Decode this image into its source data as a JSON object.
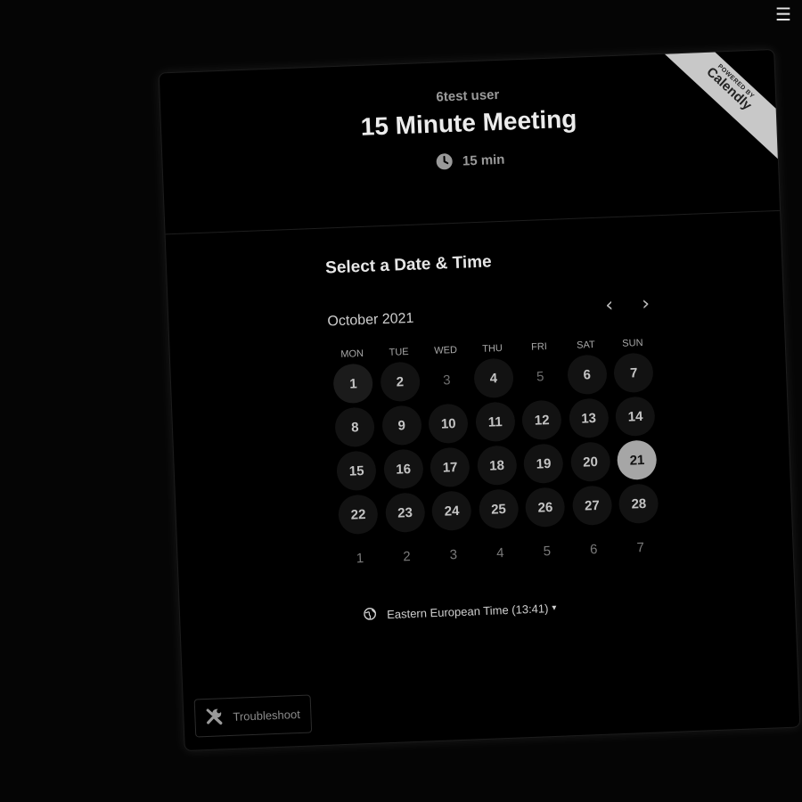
{
  "menu": {
    "icon": "hamburger-menu-icon",
    "glyph": "☰"
  },
  "ribbon": {
    "small_label": "POWERED BY",
    "brand": "Calendly"
  },
  "event": {
    "host": "6test user",
    "title": "15 Minute Meeting",
    "duration": "15 min",
    "duration_icon": "clock-icon"
  },
  "picker": {
    "heading": "Select a Date & Time",
    "month": "October 2021",
    "prev_icon": "chevron-left-icon",
    "next_icon": "chevron-right-icon",
    "prev_glyph": "‹",
    "next_glyph": "›",
    "weekdays": [
      "MON",
      "TUE",
      "WED",
      "THU",
      "FRI",
      "SAT",
      "SUN"
    ],
    "weeks": [
      [
        {
          "d": "1",
          "s": "available"
        },
        {
          "d": "2",
          "s": "available"
        },
        {
          "d": "3",
          "s": "disabled"
        },
        {
          "d": "4",
          "s": "available"
        },
        {
          "d": "5",
          "s": "disabled"
        },
        {
          "d": "6",
          "s": "available"
        },
        {
          "d": "7",
          "s": "available"
        }
      ],
      [
        {
          "d": "8",
          "s": "available"
        },
        {
          "d": "9",
          "s": "available"
        },
        {
          "d": "10",
          "s": "available"
        },
        {
          "d": "11",
          "s": "available"
        },
        {
          "d": "12",
          "s": "available"
        },
        {
          "d": "13",
          "s": "available"
        },
        {
          "d": "14",
          "s": "available"
        }
      ],
      [
        {
          "d": "15",
          "s": "available"
        },
        {
          "d": "16",
          "s": "available"
        },
        {
          "d": "17",
          "s": "available"
        },
        {
          "d": "18",
          "s": "available"
        },
        {
          "d": "19",
          "s": "available"
        },
        {
          "d": "20",
          "s": "available"
        },
        {
          "d": "21",
          "s": "selected"
        }
      ],
      [
        {
          "d": "22",
          "s": "available"
        },
        {
          "d": "23",
          "s": "available"
        },
        {
          "d": "24",
          "s": "available"
        },
        {
          "d": "25",
          "s": "available"
        },
        {
          "d": "26",
          "s": "available"
        },
        {
          "d": "27",
          "s": "available"
        },
        {
          "d": "28",
          "s": "available"
        }
      ],
      [
        {
          "d": "1",
          "s": "outside"
        },
        {
          "d": "2",
          "s": "outside"
        },
        {
          "d": "3",
          "s": "outside"
        },
        {
          "d": "4",
          "s": "outside"
        },
        {
          "d": "5",
          "s": "outside"
        },
        {
          "d": "6",
          "s": "outside"
        },
        {
          "d": "7",
          "s": "outside"
        }
      ]
    ],
    "timezone": "Eastern European Time (13:41)",
    "timezone_icon": "globe-icon",
    "timezone_caret": "▾"
  },
  "troubleshoot": {
    "label": "Troubleshoot",
    "icon": "wrench-icon"
  },
  "colors": {
    "background": "#050505",
    "card": "#000000",
    "selected_day": "#a6a6a6",
    "available_day": "#121212",
    "ribbon": "#c8c8c8"
  }
}
